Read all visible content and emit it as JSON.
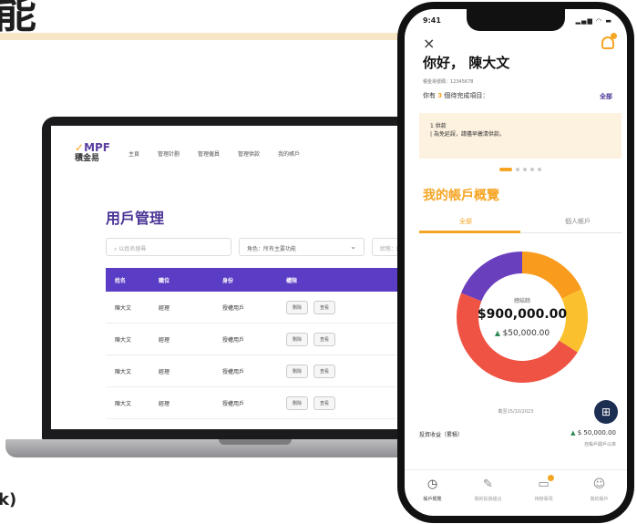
{
  "page": {
    "heading": "能",
    "bottom_text": "k)"
  },
  "laptop": {
    "logo": {
      "mark": "MPF",
      "sub": "積金易"
    },
    "nav": [
      "主頁",
      "管理計劃",
      "管理僱員",
      "管理供款",
      "我的帳戶"
    ],
    "title": "用戶管理",
    "search_placeholder": "以姓名搜尋",
    "filter1": "角色：所有主要功能",
    "filter2": "狀態：所有",
    "columns": [
      "姓名",
      "職位",
      "身份",
      "權限"
    ],
    "rows": [
      {
        "name": "陳大文",
        "role": "經理",
        "status": "授權用戶",
        "actions": [
          "刪除",
          "查看"
        ]
      },
      {
        "name": "陳大文",
        "role": "經理",
        "status": "授權用戶",
        "actions": [
          "刪除",
          "查看"
        ]
      },
      {
        "name": "陳大文",
        "role": "經理",
        "status": "授權用戶",
        "actions": [
          "刪除",
          "查看"
        ]
      },
      {
        "name": "陳大文",
        "role": "經理",
        "status": "授權用戶",
        "actions": [
          "刪除",
          "查看"
        ]
      }
    ]
  },
  "phone": {
    "time": "9:41",
    "status_icons": "▂▄▆ ◠ ▬",
    "greeting": "你好， 陳大文",
    "member_no": "積金易號碼：12345678",
    "pending_pre": "你有",
    "pending_count": "3",
    "pending_post": "個待完成項目：",
    "all_label": "全部",
    "notice_lines": [
      "1 供款",
      "| 為免延誤，請儘早繳清供款。"
    ],
    "overview_title": "我的帳戶概覽",
    "tabs": [
      "全部",
      "個人帳戶"
    ],
    "donut": {
      "label": "總結餘",
      "total": "$900,000.00",
      "change": "$50,000.00",
      "change_dir": "up"
    },
    "as_of": "截至15/10/2023",
    "returns_label": "投資收益（累積）",
    "returns_value": "$ 50,000.00",
    "returns_sub": "自帳戶開戶以來",
    "bottom_nav": [
      "帳戶概覽",
      "我的投資組合",
      "待辦事項",
      "我的帳戶"
    ],
    "colors": {
      "accent": "#f5a524",
      "purple": "#5b3cc4",
      "red": "#ef5343",
      "navy": "#1c2e52"
    }
  },
  "chart_data": {
    "type": "pie",
    "title": "",
    "categories": [
      "orange",
      "yellow",
      "red",
      "purple"
    ],
    "values": [
      0.18,
      0.16,
      0.47,
      0.19
    ],
    "colors": [
      "#f99b1c",
      "#fbc02d",
      "#ef5343",
      "#6a3fbd"
    ]
  }
}
